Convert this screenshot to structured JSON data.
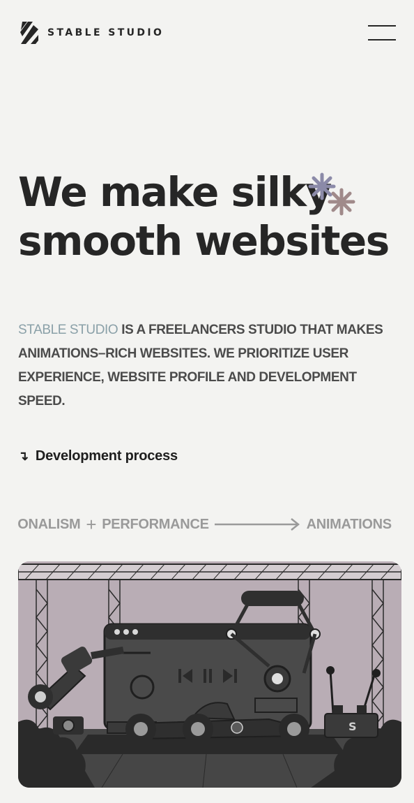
{
  "header": {
    "brand_name": "STABLE STUDIO",
    "menu_icon": "hamburger-menu-icon"
  },
  "hero": {
    "title_line1": "We make silky",
    "title_line2": "smooth websites",
    "sparkle_colors": [
      "#8b8aa8",
      "#a08a8a"
    ]
  },
  "intro": {
    "brand": "STABLE STUDIO",
    "text": " IS A FREELANCERS STUDIO THAT MAKES ANIMATIONS–RICH WEBSITES. WE PRIORITIZE USER EXPERIENCE, WEBSITE PROFILE AND DEVELOPMENT SPEED."
  },
  "process_link": {
    "arrow": "↴",
    "label": "Development process"
  },
  "marquee": {
    "items": [
      "IONALISM",
      "PERFORMANCE",
      "ANIMATIONS"
    ]
  },
  "colors": {
    "background": "#f3f3f1",
    "text": "#262626",
    "accent_muted": "#8aa0a8",
    "illustration_bg": "#b9adb5"
  }
}
